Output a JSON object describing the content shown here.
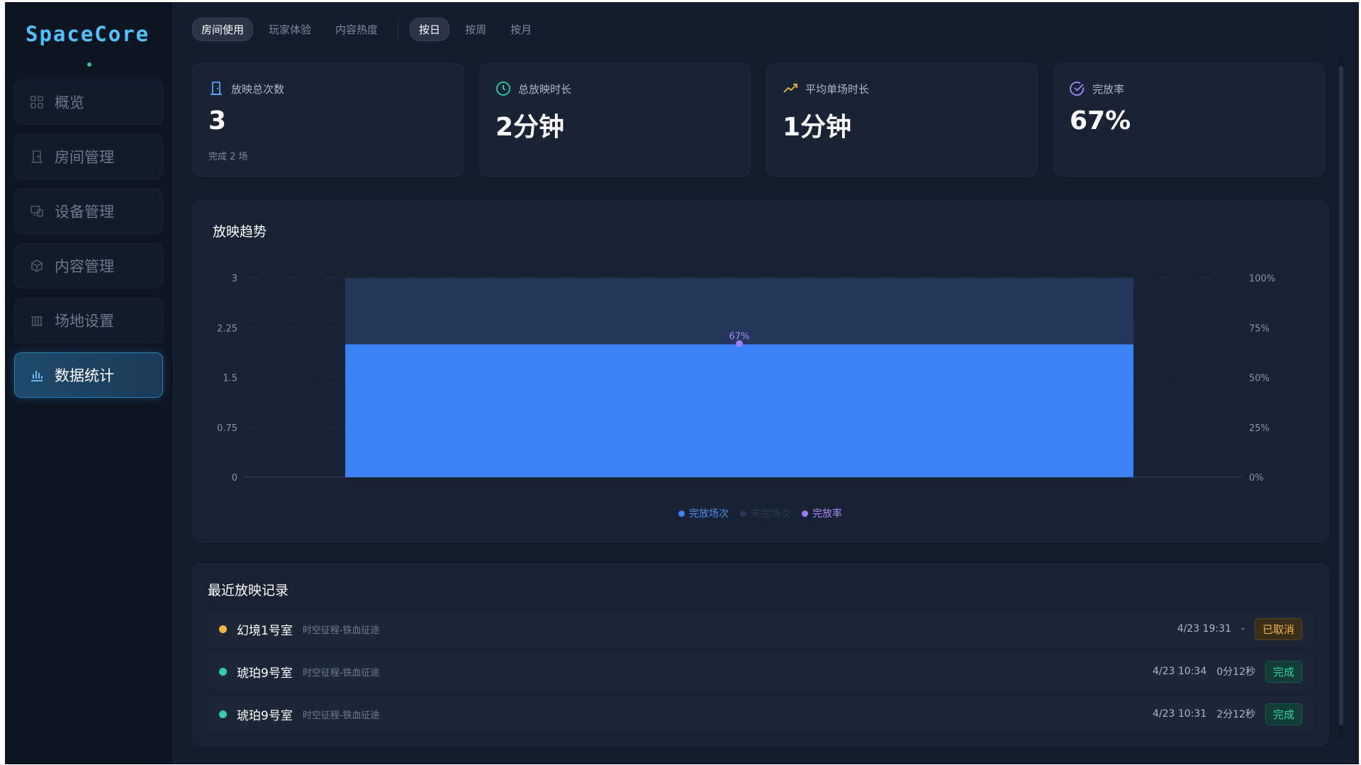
{
  "app": {
    "logo": "SpaceCore"
  },
  "sidebar": {
    "items": [
      {
        "label": "概览",
        "icon": "grid-icon",
        "active": false
      },
      {
        "label": "房间管理",
        "icon": "door-icon",
        "active": false
      },
      {
        "label": "设备管理",
        "icon": "devices-icon",
        "active": false
      },
      {
        "label": "内容管理",
        "icon": "cube-icon",
        "active": false
      },
      {
        "label": "场地设置",
        "icon": "venue-icon",
        "active": false
      },
      {
        "label": "数据统计",
        "icon": "bar-chart-icon",
        "active": true
      }
    ]
  },
  "tabs": {
    "categories": [
      "房间使用",
      "玩家体验",
      "内容热度"
    ],
    "active_category": "房间使用",
    "periods": [
      "按日",
      "按周",
      "按月"
    ],
    "active_period": "按日"
  },
  "kpis": [
    {
      "label": "放映总次数",
      "value": "3",
      "sub": "完成 2 场",
      "icon": "door-icon",
      "color": "#5ea6ff"
    },
    {
      "label": "总放映时长",
      "value": "2分钟",
      "sub": "",
      "icon": "clock-icon",
      "color": "#2fd2a6"
    },
    {
      "label": "平均单场时长",
      "value": "1分钟",
      "sub": "",
      "icon": "trend-up-icon",
      "color": "#f4b740"
    },
    {
      "label": "完放率",
      "value": "67%",
      "sub": "",
      "icon": "check-circle-icon",
      "color": "#a88bf5"
    }
  ],
  "trend": {
    "title": "放映趋势",
    "legend": [
      {
        "label": "完放场次",
        "color": "#3b82f6",
        "text_color": "#4a90f0"
      },
      {
        "label": "未完场次",
        "color": "#23375a",
        "text_color": "#2a3b56"
      },
      {
        "label": "完放率",
        "color": "#9b7cf0",
        "text_color": "#a88bf5"
      }
    ]
  },
  "chart_data": {
    "type": "bar",
    "stacked": true,
    "categories": [
      ""
    ],
    "series": [
      {
        "name": "完放场次",
        "values": [
          2
        ],
        "axis": "left"
      },
      {
        "name": "未完场次",
        "values": [
          1
        ],
        "axis": "left"
      },
      {
        "name": "完放率",
        "values": [
          67
        ],
        "axis": "right",
        "type": "line",
        "label": "67%"
      }
    ],
    "ylim": [
      0,
      3
    ],
    "y_ticks": [
      "0",
      "0.75",
      "1.5",
      "2.25",
      "3"
    ],
    "y2lim": [
      0,
      100
    ],
    "y2_ticks": [
      "0%",
      "25%",
      "50%",
      "75%",
      "100%"
    ],
    "grid": true,
    "legend_position": "bottom"
  },
  "records": {
    "title": "最近放映记录",
    "items": [
      {
        "room": "幻境1号室",
        "title": "时空征程-铁血征途",
        "time": "4/23 19:31",
        "duration": "-",
        "status": "已取消",
        "status_type": "cancel",
        "dot": "#f4b740"
      },
      {
        "room": "琥珀9号室",
        "title": "时空征程-铁血征途",
        "time": "4/23 10:34",
        "duration": "0分12秒",
        "status": "完成",
        "status_type": "done",
        "dot": "#2fd2a6"
      },
      {
        "room": "琥珀9号室",
        "title": "时空征程-铁血征途",
        "time": "4/23 10:31",
        "duration": "2分12秒",
        "status": "完成",
        "status_type": "done",
        "dot": "#2fd2a6"
      }
    ]
  }
}
